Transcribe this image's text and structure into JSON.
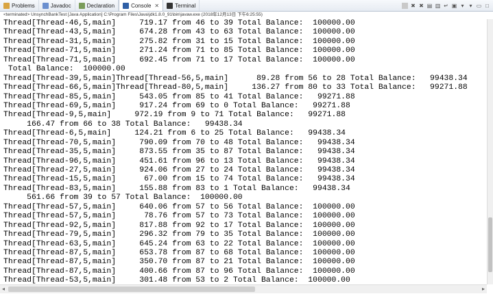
{
  "tabs": [
    {
      "label": "Problems",
      "icon": "problems-icon"
    },
    {
      "label": "Javadoc",
      "icon": "javadoc-icon"
    },
    {
      "label": "Declaration",
      "icon": "declaration-icon"
    },
    {
      "label": "Console",
      "icon": "console-icon",
      "active": true
    },
    {
      "label": "Terminal",
      "icon": "terminal-icon"
    }
  ],
  "console_close": "✕",
  "status_text": "<terminated> UnsynchBankTest [Java Application] C:\\Program Files\\Java\\jdk1.8.0_91\\bin\\javaw.exe (2018年12月13日 下午6:25:55)",
  "lines": [
    "Thread[Thread-46,5,main]     719.17 from 46 to 39 Total Balance:  100000.00",
    "Thread[Thread-43,5,main]     674.28 from 43 to 63 Total Balance:  100000.00",
    "Thread[Thread-31,5,main]     275.82 from 31 to 15 Total Balance:  100000.00",
    "Thread[Thread-71,5,main]     271.24 from 71 to 85 Total Balance:  100000.00",
    "Thread[Thread-71,5,main]     692.45 from 71 to 17 Total Balance:  100000.00",
    " Total Balance:  100000.00",
    "Thread[Thread-39,5,main]Thread[Thread-56,5,main]      89.28 from 56 to 28 Total Balance:   99438.34",
    "Thread[Thread-66,5,main]Thread[Thread-80,5,main]     136.27 from 80 to 33 Total Balance:   99271.88",
    "Thread[Thread-85,5,main]     543.05 from 85 to 41 Total Balance:   99271.88",
    "Thread[Thread-69,5,main]     917.24 from 69 to 0 Total Balance:   99271.88",
    "Thread[Thread-9,5,main]     972.19 from 9 to 71 Total Balance:   99271.88",
    "     166.47 from 66 to 38 Total Balance:   99438.34",
    "Thread[Thread-6,5,main]     124.21 from 6 to 25 Total Balance:   99438.34",
    "Thread[Thread-70,5,main]     790.09 from 70 to 48 Total Balance:   99438.34",
    "Thread[Thread-35,5,main]     873.55 from 35 to 87 Total Balance:   99438.34",
    "Thread[Thread-96,5,main]     451.61 from 96 to 13 Total Balance:   99438.34",
    "Thread[Thread-27,5,main]     924.06 from 27 to 24 Total Balance:   99438.34",
    "Thread[Thread-15,5,main]      67.00 from 15 to 74 Total Balance:   99438.34",
    "Thread[Thread-83,5,main]     155.88 from 83 to 1 Total Balance:   99438.34",
    "     561.66 from 39 to 57 Total Balance:  100000.00",
    "Thread[Thread-57,5,main]     640.06 from 57 to 56 Total Balance:  100000.00",
    "Thread[Thread-57,5,main]      78.76 from 57 to 73 Total Balance:  100000.00",
    "Thread[Thread-92,5,main]     817.88 from 92 to 17 Total Balance:  100000.00",
    "Thread[Thread-79,5,main]     296.32 from 79 to 35 Total Balance:  100000.00",
    "Thread[Thread-63,5,main]     645.24 from 63 to 22 Total Balance:  100000.00",
    "Thread[Thread-87,5,main]     653.78 from 87 to 68 Total Balance:  100000.00",
    "Thread[Thread-87,5,main]     350.70 from 87 to 21 Total Balance:  100000.00",
    "Thread[Thread-87,5,main]     400.66 from 87 to 96 Total Balance:  100000.00",
    "Thread[Thread-53,5,main]     301.48 from 53 to 2 Total Balance:  100000.00"
  ]
}
